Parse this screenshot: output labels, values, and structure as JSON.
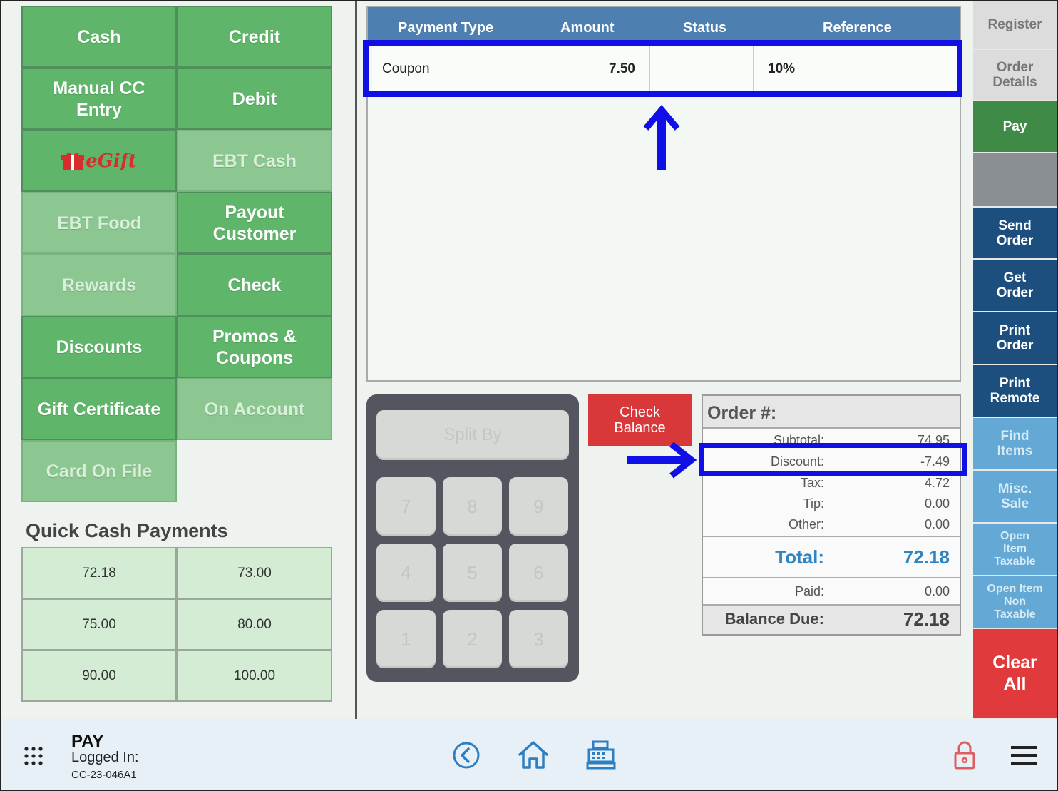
{
  "payment_buttons": {
    "cash": "Cash",
    "credit": "Credit",
    "manual_cc_entry": "Manual CC Entry",
    "debit": "Debit",
    "egift": "eGift",
    "ebt_cash": "EBT Cash",
    "ebt_food": "EBT Food",
    "payout_customer": "Payout Customer",
    "rewards": "Rewards",
    "check": "Check",
    "discounts": "Discounts",
    "promos_coupons": "Promos & Coupons",
    "gift_certificate": "Gift Certificate",
    "on_account": "On Account",
    "card_on_file": "Card On File"
  },
  "quick_cash": {
    "title": "Quick Cash Payments",
    "amounts": [
      "72.18",
      "73.00",
      "75.00",
      "80.00",
      "90.00",
      "100.00"
    ]
  },
  "payments_table": {
    "headers": [
      "Payment Type",
      "Amount",
      "Status",
      "Reference"
    ],
    "rows": [
      {
        "type": "Coupon",
        "amount": "7.50",
        "status": "",
        "reference": "10%"
      }
    ]
  },
  "keypad": {
    "split_by": "Split By",
    "keys": [
      "7",
      "8",
      "9",
      "4",
      "5",
      "6",
      "1",
      "2",
      "3"
    ]
  },
  "check_balance": "Check Balance",
  "order_summary": {
    "title": "Order #:",
    "subtotal_label": "Subtotal:",
    "subtotal": "74.95",
    "discount_label": "Discount:",
    "discount": "-7.49",
    "tax_label": "Tax:",
    "tax": "4.72",
    "tip_label": "Tip:",
    "tip": "0.00",
    "other_label": "Other:",
    "other": "0.00",
    "total_label": "Total:",
    "total": "72.18",
    "paid_label": "Paid:",
    "paid": "0.00",
    "balance_label": "Balance Due:",
    "balance": "72.18"
  },
  "right_rail": {
    "register": "Register",
    "order_details": "Order Details",
    "pay": "Pay",
    "send_order": "Send Order",
    "get_order": "Get Order",
    "print_order": "Print Order",
    "print_remote": "Print Remote",
    "find_items": "Find Items",
    "misc_sale": "Misc. Sale",
    "open_item_taxable": "Open Item Taxable",
    "open_item_non_taxable": "Open Item Non Taxable",
    "clear_all": "Clear All"
  },
  "bottom_bar": {
    "screen": "PAY",
    "logged_in": "Logged In:",
    "terminal": "CC-23-046A1"
  },
  "colors": {
    "pay_green": "#5fb56a",
    "header_blue": "#4d7fb0",
    "navy": "#1d4f7e",
    "highlight_blue": "#1010e6",
    "clear_red": "#e03a3d"
  }
}
